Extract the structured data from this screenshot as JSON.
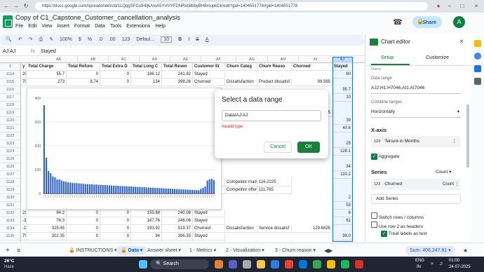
{
  "browser": {
    "url": "https://docs.google.com/spreadsheets/d/1LQqgSFCutHiljkAIoA5YvIVYFDNRxb8bbyBH8mopkCk/edit?gid=1404551778#gid=1404551778"
  },
  "doc": {
    "title": "Copy of C1_Capstone_Customer_cancellation_analysis",
    "menu": [
      "File",
      "Edit",
      "View",
      "Insert",
      "Format",
      "Data",
      "Tools",
      "Extensions",
      "Help"
    ],
    "share": "Share",
    "avatar": "A"
  },
  "toolbar": {
    "zoom": "100%",
    "currency": "$",
    "percent": "%",
    "dec1": ".0",
    "dec2": ".00",
    "fmt": "123",
    "font": "Defaul...",
    "size": "10"
  },
  "formula": {
    "ref": "AJ:AJ",
    "value": "Stayed"
  },
  "columns": [
    "AA",
    "AB",
    "AC",
    "AD",
    "AE",
    "AF",
    "AG",
    "AH",
    "AI",
    "AJ"
  ],
  "headers": [
    "y Chi",
    "Total Charge",
    "Total Refunc",
    "Total Extra D",
    "Total Long C",
    "Total Reven",
    "Customer St",
    "Churn Categ",
    "Churn Reaso",
    "Churned",
    "Stayed"
  ],
  "rows": [
    {
      "n": "1114",
      "c": [
        "20.2",
        "55.7",
        "0",
        "0",
        "186.12",
        "241.82",
        "Stayed",
        "",
        "",
        "",
        "60"
      ]
    },
    {
      "n": "1115",
      "c": [
        "70.9",
        "273",
        "8.74",
        "0",
        "134",
        "398.26",
        "Churned",
        "Dissatisfaction",
        "Product dissatisf",
        "99.565",
        ""
      ]
    },
    {
      "n": "1116",
      "c": [
        "",
        "",
        "",
        "",
        "",
        "",
        "",
        "",
        "",
        "",
        "95.7"
      ]
    },
    {
      "n": "1117",
      "c": [
        "",
        "",
        "",
        "",
        "",
        "",
        "",
        "",
        "",
        "",
        "10"
      ]
    },
    {
      "n": "1118",
      "c": [
        "",
        "",
        "",
        "",
        "",
        "",
        "",
        "",
        "",
        "",
        ""
      ]
    },
    {
      "n": "1119",
      "c": [
        "",
        "",
        "",
        "",
        "",
        "",
        "",
        "",
        "",
        "75",
        ""
      ]
    },
    {
      "n": "1120",
      "c": [
        "",
        "",
        "",
        "",
        "",
        "",
        "",
        "",
        "",
        "",
        "39"
      ]
    },
    {
      "n": "1121",
      "c": [
        "",
        "",
        "",
        "",
        "",
        "",
        "",
        "",
        "",
        "",
        "40.6"
      ]
    },
    {
      "n": "1122",
      "c": [
        "",
        "",
        "",
        "",
        "",
        "",
        "",
        "",
        "",
        "",
        ""
      ]
    },
    {
      "n": "1123",
      "c": [
        "",
        "",
        "",
        "",
        "",
        "",
        "",
        "",
        "",
        "",
        "25"
      ]
    },
    {
      "n": "1124",
      "c": [
        "",
        "",
        "",
        "",
        "",
        "",
        "",
        "",
        "",
        "",
        "128.1"
      ]
    },
    {
      "n": "1125",
      "c": [
        "",
        "",
        "",
        "",
        "",
        "",
        "",
        "",
        "",
        "",
        ""
      ]
    },
    {
      "n": "1126",
      "c": [
        "",
        "",
        "",
        "",
        "",
        "",
        "",
        "",
        "",
        "",
        "34"
      ]
    },
    {
      "n": "1127",
      "c": [
        "",
        "",
        "",
        "",
        "",
        "",
        "",
        "",
        "",
        "",
        "110.2"
      ]
    },
    {
      "n": "1128",
      "c": [
        "",
        "",
        "",
        "",
        "",
        "Churned",
        "Competitor",
        "Competitor made",
        "116.2225",
        ""
      ]
    },
    {
      "n": "1129",
      "c": [
        "",
        "",
        "",
        "",
        "",
        "Churned",
        "Competitor",
        "Competitor offer",
        "111.765",
        ""
      ]
    },
    {
      "n": "1130",
      "c": [
        "",
        "",
        "",
        "",
        "",
        "",
        "",
        "",
        "",
        "",
        "2"
      ]
    },
    {
      "n": "1131",
      "c": [
        "",
        "",
        "",
        "",
        "",
        "",
        "",
        "",
        "",
        "",
        "53"
      ]
    },
    {
      "n": "1132",
      "c": [
        "25.45",
        "84.2",
        "0",
        "0",
        "155.88",
        "240.08",
        "Stayed",
        "",
        "",
        "",
        "6"
      ]
    },
    {
      "n": "1133",
      "c": [
        "-3",
        "78.3",
        "0",
        "0",
        "167.76",
        "246.06",
        "Stayed",
        "",
        "",
        "",
        "61"
      ]
    },
    {
      "n": "1134",
      "c": [
        "-1",
        "325.45",
        "0",
        "0",
        "193.92",
        "519.37",
        "Churned",
        "Dissatisfaction",
        "Service dissatisf",
        "129.8425",
        ""
      ]
    },
    {
      "n": "1135",
      "c": [
        "75.65",
        "302.35",
        "0",
        "0",
        "94",
        "396.35",
        "Stayed",
        "",
        "",
        "",
        "99.0"
      ]
    },
    {
      "n": "1136",
      "c": [
        "84.6",
        "360.1",
        "0",
        "0",
        "26.72",
        "386.82",
        "Churned",
        "Competitor",
        "Competitor had b",
        "96.705",
        ""
      ]
    }
  ],
  "chart_data": {
    "type": "bar",
    "ylim": [
      0,
      400
    ],
    "yticks": [
      "0",
      "100",
      "200",
      "300",
      "400"
    ],
    "values": [
      370,
      150,
      95,
      85,
      72,
      68,
      60,
      60,
      55,
      52,
      50,
      48,
      46,
      45,
      44,
      44,
      43,
      42,
      41,
      40,
      40,
      39,
      39,
      38,
      38,
      37,
      37,
      36,
      36,
      35,
      35,
      34,
      34,
      33,
      33,
      32,
      32,
      31,
      31,
      30,
      30,
      29,
      29,
      28,
      28,
      27,
      27,
      26,
      26,
      25,
      25,
      24,
      24,
      23,
      23,
      22,
      22,
      21,
      21,
      20,
      20,
      19,
      19,
      18,
      18,
      17,
      17,
      16,
      16,
      15,
      15,
      14,
      20,
      25,
      30,
      55,
      60,
      62,
      56
    ]
  },
  "dialog": {
    "title": "Select a data range",
    "value": "Data!AJ:AJ",
    "error": "Invalid type",
    "cancel": "Cancel",
    "ok": "OK"
  },
  "sidebar": {
    "title": "Chart editor",
    "tab_setup": "Setup",
    "tab_customize": "Customize",
    "data_range_label": "Data range",
    "data_range": "AJ2:H1:H7046,AI1:AI7046",
    "combine_label": "Combine ranges",
    "combine": "Horizontally",
    "xaxis_label": "X-axis",
    "xaxis": "Tenure in Months",
    "aggregate": "Aggregate",
    "series_label": "Series",
    "series_agg": "Count",
    "series_name": "Churned",
    "series_val": "Count",
    "add_series": "Add Series",
    "switch": "Switch rows / columns",
    "use_row": "Use row 2 as headers",
    "treat": "Treat labels as text",
    "hidden_field": "Name"
  },
  "sheets": {
    "tabs": [
      "INSTRUCTIONS",
      "Data",
      "Answer sheet",
      "1 - Metrics",
      "2 - Visualization",
      "3 - Churn reason"
    ],
    "sum": "Sum: 406,247.91"
  },
  "taskbar": {
    "temp": "26°C",
    "weather": "Haze",
    "search": "Search",
    "lang1": "ENG",
    "lang2": "IN",
    "time": "01:00",
    "date": "24-07-2025"
  }
}
